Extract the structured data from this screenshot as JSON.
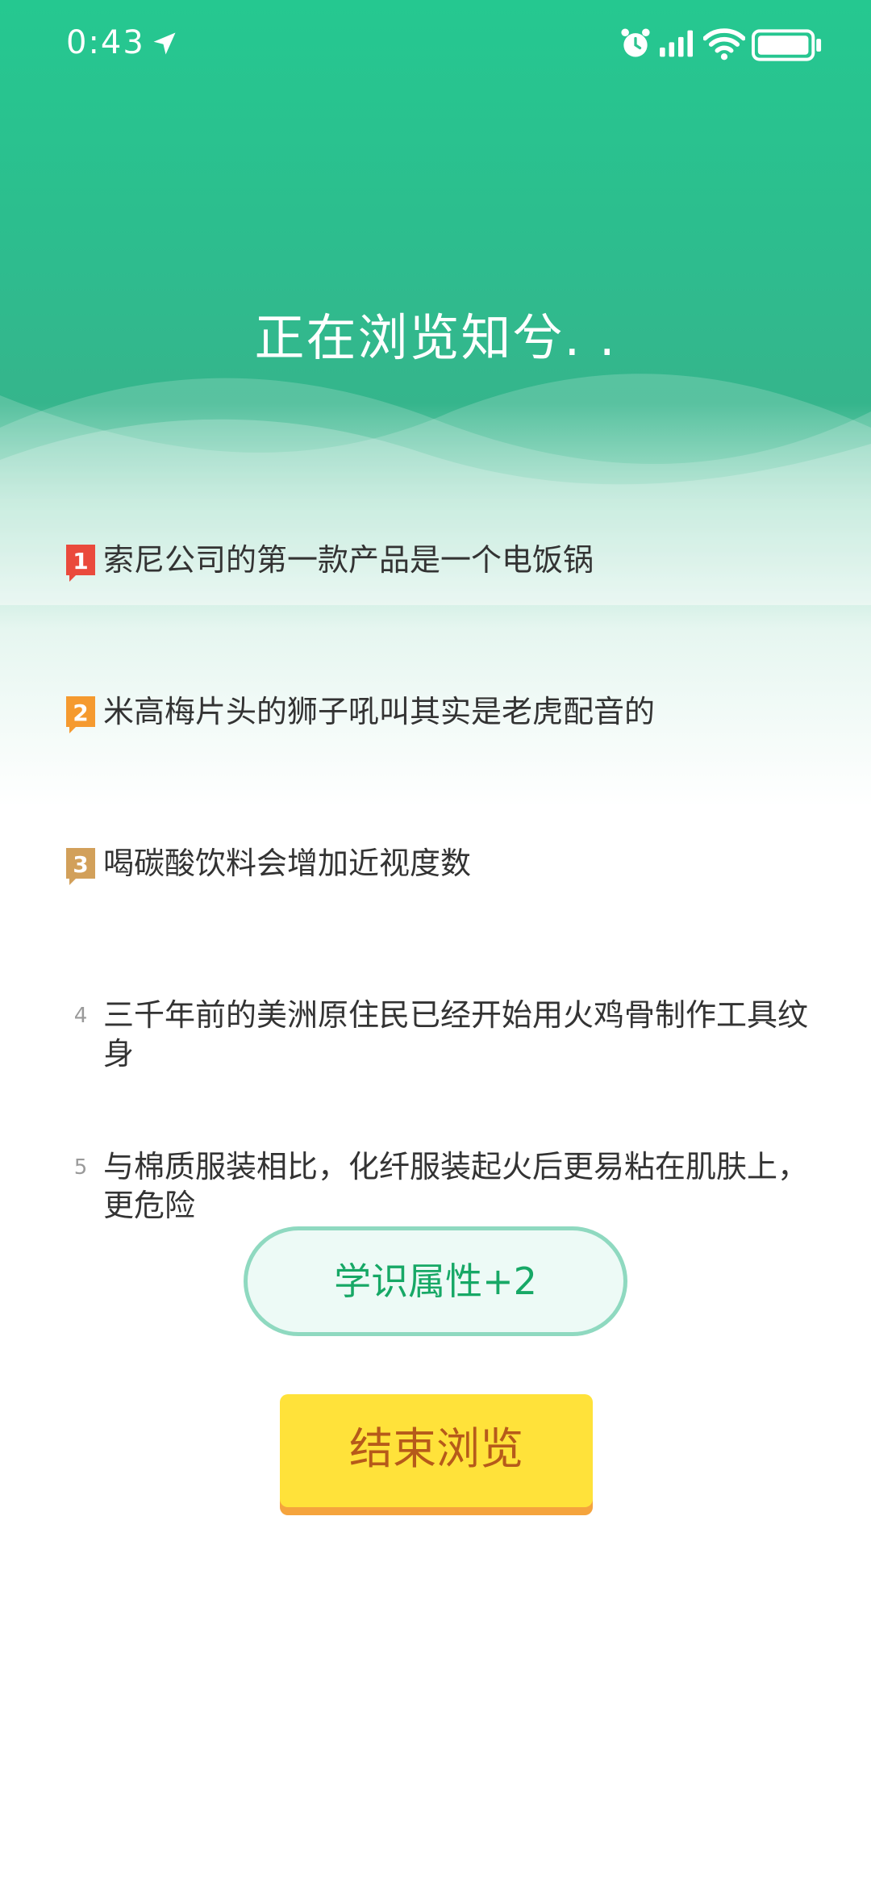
{
  "status_bar": {
    "time": "0:43",
    "icons": [
      "location-arrow-icon",
      "alarm-icon",
      "signal-icon",
      "wifi-icon",
      "battery-icon"
    ]
  },
  "page": {
    "title": "正在浏览知兮. ."
  },
  "facts": [
    {
      "rank": "1",
      "text": "索尼公司的第一款产品是一个电饭锅",
      "badge_color": "#ea4a3c"
    },
    {
      "rank": "2",
      "text": "米高梅片头的狮子吼叫其实是老虎配音的",
      "badge_color": "#f59a2f"
    },
    {
      "rank": "3",
      "text": "喝碳酸饮料会增加近视度数",
      "badge_color": "#d2a05a"
    },
    {
      "rank": "4",
      "text": "三千年前的美洲原住民已经开始用火鸡骨制作工具纹身"
    },
    {
      "rank": "5",
      "text": "与棉质服装相比，化纤服装起火后更易粘在肌肤上，更危险"
    }
  ],
  "reward": {
    "label": "学识属性+2"
  },
  "end_button": {
    "label": "结束浏览"
  },
  "colors": {
    "header_green": "#25c890",
    "reward_text": "#17a866",
    "button_yellow": "#ffe23a",
    "button_shadow": "#f5a43d",
    "button_text": "#b65a1a"
  }
}
